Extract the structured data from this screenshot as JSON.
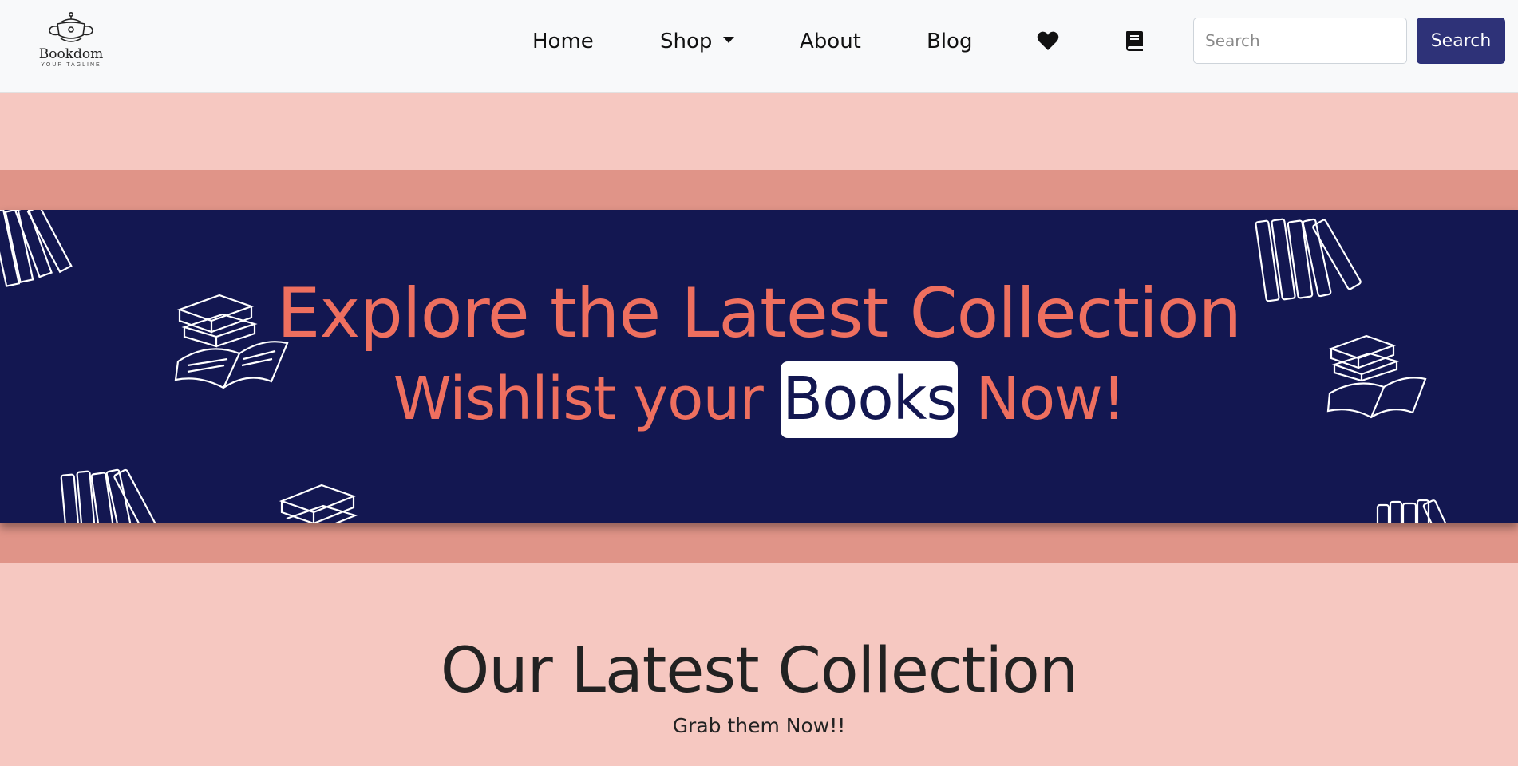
{
  "brand": {
    "name": "Bookdom",
    "tagline": "YOUR TAGLINE",
    "logo_icon": "teapot-logo-icon"
  },
  "nav": {
    "items": [
      {
        "label": "Home"
      },
      {
        "label": "Shop",
        "has_dropdown": true
      },
      {
        "label": "About"
      },
      {
        "label": "Blog"
      }
    ],
    "icons": [
      "heart-icon",
      "book-icon"
    ]
  },
  "search": {
    "placeholder": "Search",
    "value": "",
    "button_label": "Search"
  },
  "hero": {
    "title": "Explore the Latest Collection",
    "subtitle_before": "Wishlist your ",
    "subtitle_highlight": "Books",
    "subtitle_after": " Now!",
    "decoration_icon": "stacked-books-icon"
  },
  "section": {
    "title": "Our Latest Collection",
    "subtitle": "Grab them Now!!"
  },
  "colors": {
    "navbar_bg": "#f8f9fa",
    "page_bg": "#f6c8c1",
    "band": "#e09488",
    "hero_bg": "#131751",
    "hero_text": "#ee6f5f",
    "search_button": "#2e3278",
    "highlight_bg": "#ffffff"
  }
}
